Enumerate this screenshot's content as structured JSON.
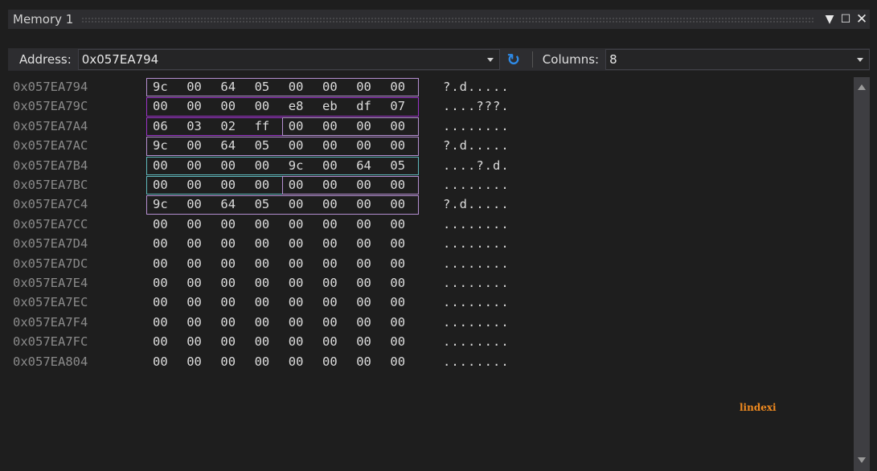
{
  "window": {
    "title": "Memory 1"
  },
  "toolbar": {
    "address_label": "Address:",
    "address_value": "0x057EA794",
    "columns_label": "Columns:",
    "columns_value": "8"
  },
  "rows": [
    {
      "address": "0x057EA794",
      "bytes": [
        "9c",
        "00",
        "64",
        "05",
        "00",
        "00",
        "00",
        "00"
      ],
      "ascii": "?.d....."
    },
    {
      "address": "0x057EA79C",
      "bytes": [
        "00",
        "00",
        "00",
        "00",
        "e8",
        "eb",
        "df",
        "07"
      ],
      "ascii": "....???."
    },
    {
      "address": "0x057EA7A4",
      "bytes": [
        "06",
        "03",
        "02",
        "ff",
        "00",
        "00",
        "00",
        "00"
      ],
      "ascii": "........"
    },
    {
      "address": "0x057EA7AC",
      "bytes": [
        "9c",
        "00",
        "64",
        "05",
        "00",
        "00",
        "00",
        "00"
      ],
      "ascii": "?.d....."
    },
    {
      "address": "0x057EA7B4",
      "bytes": [
        "00",
        "00",
        "00",
        "00",
        "9c",
        "00",
        "64",
        "05"
      ],
      "ascii": "....?.d."
    },
    {
      "address": "0x057EA7BC",
      "bytes": [
        "00",
        "00",
        "00",
        "00",
        "00",
        "00",
        "00",
        "00"
      ],
      "ascii": "........"
    },
    {
      "address": "0x057EA7C4",
      "bytes": [
        "9c",
        "00",
        "64",
        "05",
        "00",
        "00",
        "00",
        "00"
      ],
      "ascii": "?.d....."
    },
    {
      "address": "0x057EA7CC",
      "bytes": [
        "00",
        "00",
        "00",
        "00",
        "00",
        "00",
        "00",
        "00"
      ],
      "ascii": "........"
    },
    {
      "address": "0x057EA7D4",
      "bytes": [
        "00",
        "00",
        "00",
        "00",
        "00",
        "00",
        "00",
        "00"
      ],
      "ascii": "........"
    },
    {
      "address": "0x057EA7DC",
      "bytes": [
        "00",
        "00",
        "00",
        "00",
        "00",
        "00",
        "00",
        "00"
      ],
      "ascii": "........"
    },
    {
      "address": "0x057EA7E4",
      "bytes": [
        "00",
        "00",
        "00",
        "00",
        "00",
        "00",
        "00",
        "00"
      ],
      "ascii": "........"
    },
    {
      "address": "0x057EA7EC",
      "bytes": [
        "00",
        "00",
        "00",
        "00",
        "00",
        "00",
        "00",
        "00"
      ],
      "ascii": "........"
    },
    {
      "address": "0x057EA7F4",
      "bytes": [
        "00",
        "00",
        "00",
        "00",
        "00",
        "00",
        "00",
        "00"
      ],
      "ascii": "........"
    },
    {
      "address": "0x057EA7FC",
      "bytes": [
        "00",
        "00",
        "00",
        "00",
        "00",
        "00",
        "00",
        "00"
      ],
      "ascii": "........"
    },
    {
      "address": "0x057EA804",
      "bytes": [
        "00",
        "00",
        "00",
        "00",
        "00",
        "00",
        "00",
        "00"
      ],
      "ascii": "........"
    }
  ],
  "highlights": [
    {
      "name": "object-1",
      "color": "#b58fd1"
    },
    {
      "name": "object-2",
      "color": "#9a33c8"
    },
    {
      "name": "object-3",
      "color": "#b58fd1"
    },
    {
      "name": "object-4",
      "color": "#b58fd1"
    },
    {
      "name": "object-5",
      "color": "#5fb8bc"
    },
    {
      "name": "object-6",
      "color": "#b58fd1"
    },
    {
      "name": "object-7",
      "color": "#b58fd1"
    }
  ],
  "watermark": "lindexi",
  "icons": {
    "dropdown": "chevron-down-icon",
    "refresh": "refresh-icon",
    "close": "close-icon",
    "maximize": "maximize-icon"
  }
}
